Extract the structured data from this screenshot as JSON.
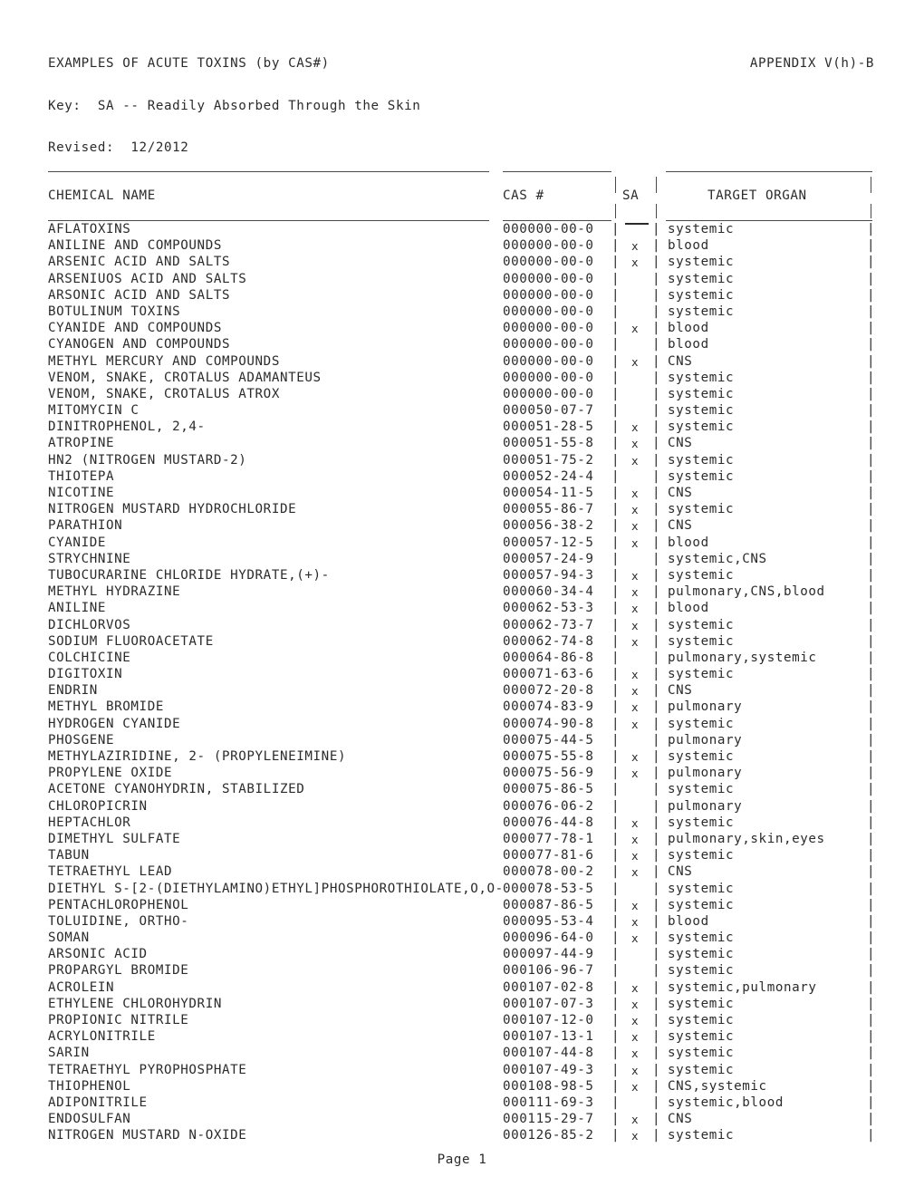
{
  "document": {
    "title": "EXAMPLES OF ACUTE TOXINS (by CAS#)",
    "appendix": "APPENDIX V(h)-B",
    "key_line": "Key:  SA -- Readily Absorbed Through the Skin",
    "revised_line": "Revised:  12/2012",
    "footer": "Page 1"
  },
  "table": {
    "headers": {
      "name": "CHEMICAL NAME",
      "cas": "CAS #",
      "sa": "SA",
      "organ": "TARGET ORGAN"
    },
    "separator_left": "|",
    "separator_right": "|",
    "separator_end": "|",
    "sa_mark": "x",
    "rows": [
      {
        "name": "AFLATOXINS",
        "cas": "000000-00-0",
        "sa": "",
        "organ": "systemic"
      },
      {
        "name": "ANILINE AND COMPOUNDS",
        "cas": "000000-00-0",
        "sa": "x",
        "organ": "blood"
      },
      {
        "name": "ARSENIC ACID AND SALTS",
        "cas": "000000-00-0",
        "sa": "x",
        "organ": "systemic"
      },
      {
        "name": "ARSENIUOS ACID AND SALTS",
        "cas": "000000-00-0",
        "sa": "",
        "organ": "systemic"
      },
      {
        "name": "ARSONIC ACID AND SALTS",
        "cas": "000000-00-0",
        "sa": "",
        "organ": "systemic"
      },
      {
        "name": "BOTULINUM TOXINS",
        "cas": "000000-00-0",
        "sa": "",
        "organ": "systemic"
      },
      {
        "name": "CYANIDE AND COMPOUNDS",
        "cas": "000000-00-0",
        "sa": "x",
        "organ": "blood"
      },
      {
        "name": "CYANOGEN AND COMPOUNDS",
        "cas": "000000-00-0",
        "sa": "",
        "organ": "blood"
      },
      {
        "name": "METHYL MERCURY AND COMPOUNDS",
        "cas": "000000-00-0",
        "sa": "x",
        "organ": "CNS"
      },
      {
        "name": "VENOM, SNAKE, CROTALUS ADAMANTEUS",
        "cas": "000000-00-0",
        "sa": "",
        "organ": "systemic"
      },
      {
        "name": "VENOM, SNAKE, CROTALUS ATROX",
        "cas": "000000-00-0",
        "sa": "",
        "organ": "systemic"
      },
      {
        "name": "MITOMYCIN C",
        "cas": "000050-07-7",
        "sa": "",
        "organ": "systemic"
      },
      {
        "name": "DINITROPHENOL, 2,4-",
        "cas": "000051-28-5",
        "sa": "x",
        "organ": "systemic"
      },
      {
        "name": "ATROPINE",
        "cas": "000051-55-8",
        "sa": "x",
        "organ": "CNS"
      },
      {
        "name": "HN2 (NITROGEN MUSTARD-2)",
        "cas": "000051-75-2",
        "sa": "x",
        "organ": "systemic"
      },
      {
        "name": "THIOTEPA",
        "cas": "000052-24-4",
        "sa": "",
        "organ": "systemic"
      },
      {
        "name": "NICOTINE",
        "cas": "000054-11-5",
        "sa": "x",
        "organ": "CNS"
      },
      {
        "name": "NITROGEN MUSTARD HYDROCHLORIDE",
        "cas": "000055-86-7",
        "sa": "x",
        "organ": "systemic"
      },
      {
        "name": "PARATHION",
        "cas": "000056-38-2",
        "sa": "x",
        "organ": "CNS"
      },
      {
        "name": "CYANIDE",
        "cas": "000057-12-5",
        "sa": "x",
        "organ": "blood"
      },
      {
        "name": "STRYCHNINE",
        "cas": "000057-24-9",
        "sa": "",
        "organ": "systemic,CNS"
      },
      {
        "name": "TUBOCURARINE CHLORIDE HYDRATE,(+)-",
        "cas": "000057-94-3",
        "sa": "x",
        "organ": "systemic"
      },
      {
        "name": "METHYL HYDRAZINE",
        "cas": "000060-34-4",
        "sa": "x",
        "organ": "pulmonary,CNS,blood"
      },
      {
        "name": "ANILINE",
        "cas": "000062-53-3",
        "sa": "x",
        "organ": "blood"
      },
      {
        "name": "DICHLORVOS",
        "cas": "000062-73-7",
        "sa": "x",
        "organ": "systemic"
      },
      {
        "name": "SODIUM FLUOROACETATE",
        "cas": "000062-74-8",
        "sa": "x",
        "organ": "systemic"
      },
      {
        "name": "COLCHICINE",
        "cas": "000064-86-8",
        "sa": "",
        "organ": "pulmonary,systemic"
      },
      {
        "name": "DIGITOXIN",
        "cas": "000071-63-6",
        "sa": "x",
        "organ": "systemic"
      },
      {
        "name": "ENDRIN",
        "cas": "000072-20-8",
        "sa": "x",
        "organ": "CNS"
      },
      {
        "name": "METHYL BROMIDE",
        "cas": "000074-83-9",
        "sa": "x",
        "organ": "pulmonary"
      },
      {
        "name": "HYDROGEN CYANIDE",
        "cas": "000074-90-8",
        "sa": "x",
        "organ": "systemic"
      },
      {
        "name": "PHOSGENE",
        "cas": "000075-44-5",
        "sa": "",
        "organ": "pulmonary"
      },
      {
        "name": "METHYLAZIRIDINE, 2- (PROPYLENEIMINE)",
        "cas": "000075-55-8",
        "sa": "x",
        "organ": "systemic"
      },
      {
        "name": "PROPYLENE OXIDE",
        "cas": "000075-56-9",
        "sa": "x",
        "organ": "pulmonary"
      },
      {
        "name": "ACETONE CYANOHYDRIN, STABILIZED",
        "cas": "000075-86-5",
        "sa": "",
        "organ": "systemic"
      },
      {
        "name": "CHLOROPICRIN",
        "cas": "000076-06-2",
        "sa": "",
        "organ": "pulmonary"
      },
      {
        "name": "HEPTACHLOR",
        "cas": "000076-44-8",
        "sa": "x",
        "organ": "systemic"
      },
      {
        "name": "DIMETHYL SULFATE",
        "cas": "000077-78-1",
        "sa": "x",
        "organ": "pulmonary,skin,eyes"
      },
      {
        "name": "TABUN",
        "cas": "000077-81-6",
        "sa": "x",
        "organ": "systemic"
      },
      {
        "name": "TETRAETHYL LEAD",
        "cas": "000078-00-2",
        "sa": "x",
        "organ": "CNS"
      },
      {
        "name": "DIETHYL S-[2-(DIETHYLAMINO)ETHYL]PHOSPHOROTHIOLATE,O,O-",
        "cas": "000078-53-5",
        "sa": "",
        "organ": "systemic"
      },
      {
        "name": "PENTACHLOROPHENOL",
        "cas": "000087-86-5",
        "sa": "x",
        "organ": "systemic"
      },
      {
        "name": "TOLUIDINE, ORTHO-",
        "cas": "000095-53-4",
        "sa": "x",
        "organ": "blood"
      },
      {
        "name": "SOMAN",
        "cas": "000096-64-0",
        "sa": "x",
        "organ": "systemic"
      },
      {
        "name": "ARSONIC ACID",
        "cas": "000097-44-9",
        "sa": "",
        "organ": "systemic"
      },
      {
        "name": "PROPARGYL BROMIDE",
        "cas": "000106-96-7",
        "sa": "",
        "organ": "systemic"
      },
      {
        "name": "ACROLEIN",
        "cas": "000107-02-8",
        "sa": "x",
        "organ": "systemic,pulmonary"
      },
      {
        "name": "ETHYLENE CHLOROHYDRIN",
        "cas": "000107-07-3",
        "sa": "x",
        "organ": "systemic"
      },
      {
        "name": "PROPIONIC NITRILE",
        "cas": "000107-12-0",
        "sa": "x",
        "organ": "systemic"
      },
      {
        "name": "ACRYLONITRILE",
        "cas": "000107-13-1",
        "sa": "x",
        "organ": "systemic"
      },
      {
        "name": "SARIN",
        "cas": "000107-44-8",
        "sa": "x",
        "organ": "systemic"
      },
      {
        "name": "TETRAETHYL PYROPHOSPHATE",
        "cas": "000107-49-3",
        "sa": "x",
        "organ": "systemic"
      },
      {
        "name": "THIOPHENOL",
        "cas": "000108-98-5",
        "sa": "x",
        "organ": "CNS,systemic"
      },
      {
        "name": "ADIPONITRILE",
        "cas": "000111-69-3",
        "sa": "",
        "organ": "systemic,blood"
      },
      {
        "name": "ENDOSULFAN",
        "cas": "000115-29-7",
        "sa": "x",
        "organ": "CNS"
      },
      {
        "name": "NITROGEN MUSTARD N-OXIDE",
        "cas": "000126-85-2",
        "sa": "x",
        "organ": "systemic"
      }
    ]
  }
}
